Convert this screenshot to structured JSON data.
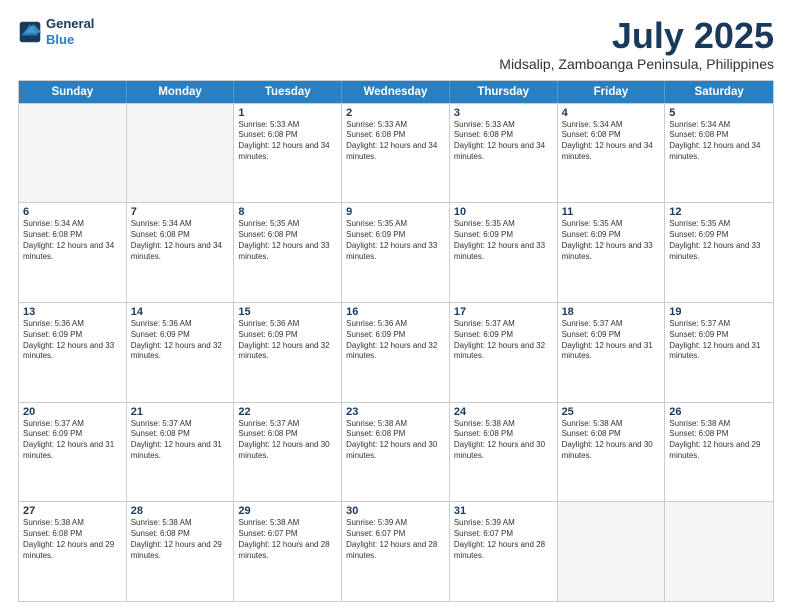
{
  "logo": {
    "line1": "General",
    "line2": "Blue"
  },
  "title": "July 2025",
  "subtitle": "Midsalip, Zamboanga Peninsula, Philippines",
  "days": [
    "Sunday",
    "Monday",
    "Tuesday",
    "Wednesday",
    "Thursday",
    "Friday",
    "Saturday"
  ],
  "weeks": [
    [
      {
        "day": "",
        "empty": true
      },
      {
        "day": "",
        "empty": true
      },
      {
        "day": "1",
        "sunrise": "5:33 AM",
        "sunset": "6:08 PM",
        "daylight": "12 hours and 34 minutes."
      },
      {
        "day": "2",
        "sunrise": "5:33 AM",
        "sunset": "6:08 PM",
        "daylight": "12 hours and 34 minutes."
      },
      {
        "day": "3",
        "sunrise": "5:33 AM",
        "sunset": "6:08 PM",
        "daylight": "12 hours and 34 minutes."
      },
      {
        "day": "4",
        "sunrise": "5:34 AM",
        "sunset": "6:08 PM",
        "daylight": "12 hours and 34 minutes."
      },
      {
        "day": "5",
        "sunrise": "5:34 AM",
        "sunset": "6:08 PM",
        "daylight": "12 hours and 34 minutes."
      }
    ],
    [
      {
        "day": "6",
        "sunrise": "5:34 AM",
        "sunset": "6:08 PM",
        "daylight": "12 hours and 34 minutes."
      },
      {
        "day": "7",
        "sunrise": "5:34 AM",
        "sunset": "6:08 PM",
        "daylight": "12 hours and 34 minutes."
      },
      {
        "day": "8",
        "sunrise": "5:35 AM",
        "sunset": "6:08 PM",
        "daylight": "12 hours and 33 minutes."
      },
      {
        "day": "9",
        "sunrise": "5:35 AM",
        "sunset": "6:09 PM",
        "daylight": "12 hours and 33 minutes."
      },
      {
        "day": "10",
        "sunrise": "5:35 AM",
        "sunset": "6:09 PM",
        "daylight": "12 hours and 33 minutes."
      },
      {
        "day": "11",
        "sunrise": "5:35 AM",
        "sunset": "6:09 PM",
        "daylight": "12 hours and 33 minutes."
      },
      {
        "day": "12",
        "sunrise": "5:35 AM",
        "sunset": "6:09 PM",
        "daylight": "12 hours and 33 minutes."
      }
    ],
    [
      {
        "day": "13",
        "sunrise": "5:36 AM",
        "sunset": "6:09 PM",
        "daylight": "12 hours and 33 minutes."
      },
      {
        "day": "14",
        "sunrise": "5:36 AM",
        "sunset": "6:09 PM",
        "daylight": "12 hours and 32 minutes."
      },
      {
        "day": "15",
        "sunrise": "5:36 AM",
        "sunset": "6:09 PM",
        "daylight": "12 hours and 32 minutes."
      },
      {
        "day": "16",
        "sunrise": "5:36 AM",
        "sunset": "6:09 PM",
        "daylight": "12 hours and 32 minutes."
      },
      {
        "day": "17",
        "sunrise": "5:37 AM",
        "sunset": "6:09 PM",
        "daylight": "12 hours and 32 minutes."
      },
      {
        "day": "18",
        "sunrise": "5:37 AM",
        "sunset": "6:09 PM",
        "daylight": "12 hours and 31 minutes."
      },
      {
        "day": "19",
        "sunrise": "5:37 AM",
        "sunset": "6:09 PM",
        "daylight": "12 hours and 31 minutes."
      }
    ],
    [
      {
        "day": "20",
        "sunrise": "5:37 AM",
        "sunset": "6:09 PM",
        "daylight": "12 hours and 31 minutes."
      },
      {
        "day": "21",
        "sunrise": "5:37 AM",
        "sunset": "6:08 PM",
        "daylight": "12 hours and 31 minutes."
      },
      {
        "day": "22",
        "sunrise": "5:37 AM",
        "sunset": "6:08 PM",
        "daylight": "12 hours and 30 minutes."
      },
      {
        "day": "23",
        "sunrise": "5:38 AM",
        "sunset": "6:08 PM",
        "daylight": "12 hours and 30 minutes."
      },
      {
        "day": "24",
        "sunrise": "5:38 AM",
        "sunset": "6:08 PM",
        "daylight": "12 hours and 30 minutes."
      },
      {
        "day": "25",
        "sunrise": "5:38 AM",
        "sunset": "6:08 PM",
        "daylight": "12 hours and 30 minutes."
      },
      {
        "day": "26",
        "sunrise": "5:38 AM",
        "sunset": "6:08 PM",
        "daylight": "12 hours and 29 minutes."
      }
    ],
    [
      {
        "day": "27",
        "sunrise": "5:38 AM",
        "sunset": "6:08 PM",
        "daylight": "12 hours and 29 minutes."
      },
      {
        "day": "28",
        "sunrise": "5:38 AM",
        "sunset": "6:08 PM",
        "daylight": "12 hours and 29 minutes."
      },
      {
        "day": "29",
        "sunrise": "5:38 AM",
        "sunset": "6:07 PM",
        "daylight": "12 hours and 28 minutes."
      },
      {
        "day": "30",
        "sunrise": "5:39 AM",
        "sunset": "6:07 PM",
        "daylight": "12 hours and 28 minutes."
      },
      {
        "day": "31",
        "sunrise": "5:39 AM",
        "sunset": "6:07 PM",
        "daylight": "12 hours and 28 minutes."
      },
      {
        "day": "",
        "empty": true
      },
      {
        "day": "",
        "empty": true
      }
    ]
  ]
}
